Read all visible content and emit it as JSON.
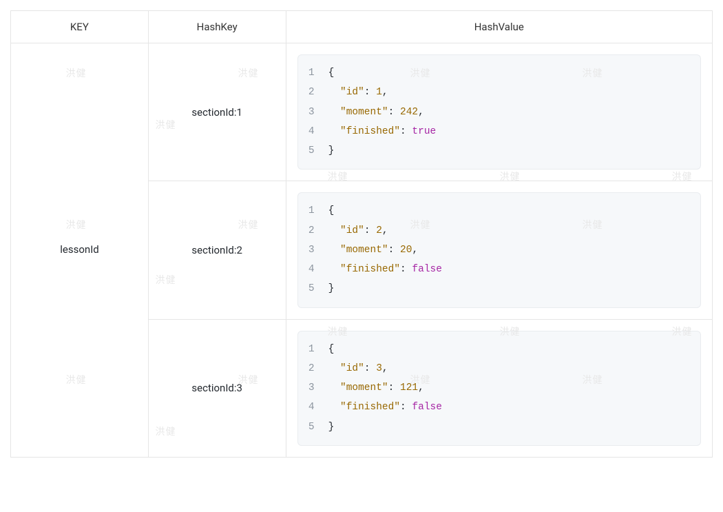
{
  "watermark_text": "洪健",
  "headers": {
    "key": "KEY",
    "hashkey": "HashKey",
    "hashvalue": "HashValue"
  },
  "keyLabel": "lessonId",
  "rows": [
    {
      "hashKey": "sectionId:1",
      "json": {
        "id": 1,
        "moment": 242,
        "finished": true
      }
    },
    {
      "hashKey": "sectionId:2",
      "json": {
        "id": 2,
        "moment": 20,
        "finished": false
      }
    },
    {
      "hashKey": "sectionId:3",
      "json": {
        "id": 3,
        "moment": 121,
        "finished": false
      }
    }
  ]
}
